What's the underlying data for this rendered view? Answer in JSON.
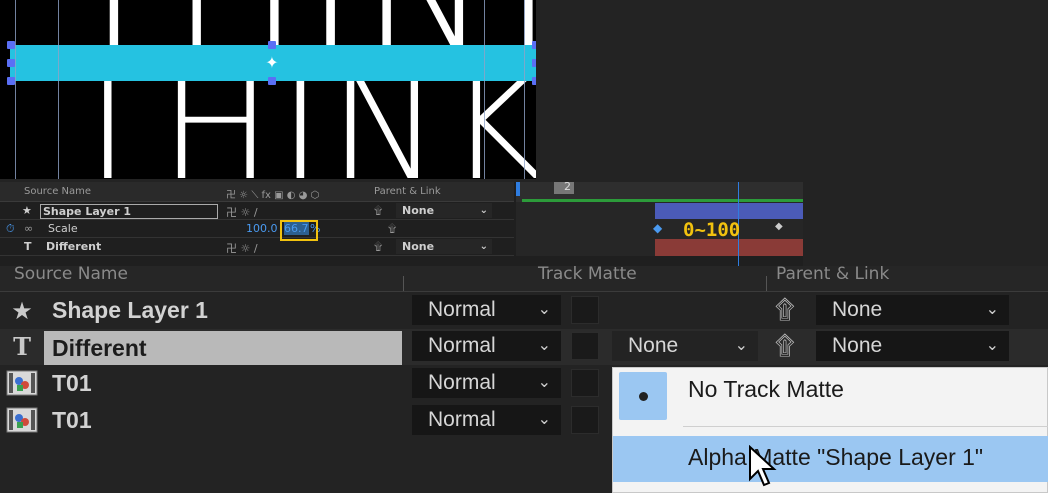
{
  "viewer": {
    "text_top": "THINK",
    "text_bottom": "THINK",
    "bar_color": "#25c2e1",
    "anchor_icon": "anchor-point-icon"
  },
  "mini_timeline": {
    "header": {
      "source_name": "Source Name",
      "switches": "卍 ☼ ⟍ fx ▣ ◐ ◕ ⬡",
      "parent_link": "Parent & Link"
    },
    "rows": [
      {
        "icon": "star-icon",
        "name": "Shape Layer 1",
        "parent": "None"
      },
      {
        "icon": "stopwatch-icon",
        "name": "Scale",
        "value_x": "100.0",
        "value_y": "66.7",
        "unit": "%"
      },
      {
        "icon": "text-layer-icon",
        "name": "Different",
        "parent": "None"
      }
    ],
    "range_label": "0~100",
    "playhead_label": "2",
    "colors": {
      "shape_bar": "#4b5bb8",
      "text_bar": "#8a3b37",
      "work_area": "#2c9b3a",
      "highlight": "#f2c20f"
    }
  },
  "panel": {
    "headers": {
      "source_name": "Source Name",
      "track_matte": "Track Matte",
      "parent_link": "Parent & Link"
    },
    "layers": [
      {
        "icon": "star-icon",
        "name": "Shape Layer 1",
        "mode": "Normal",
        "track_matte": "",
        "parent": "None"
      },
      {
        "icon": "text-layer-icon",
        "name": "Different",
        "mode": "Normal",
        "track_matte": "None",
        "parent": "None"
      },
      {
        "icon": "footage-icon",
        "name": "T01",
        "mode": "Normal",
        "track_matte": "",
        "parent": ""
      },
      {
        "icon": "footage-icon",
        "name": "T01",
        "mode": "Normal",
        "track_matte": "",
        "parent": ""
      }
    ]
  },
  "menu": {
    "items": [
      {
        "label": "No Track Matte",
        "checked": true
      },
      {
        "label": "Alpha Matte \"Shape Layer 1\"",
        "checked": false,
        "hovered": true
      }
    ],
    "accent": "#9bc7f2"
  }
}
